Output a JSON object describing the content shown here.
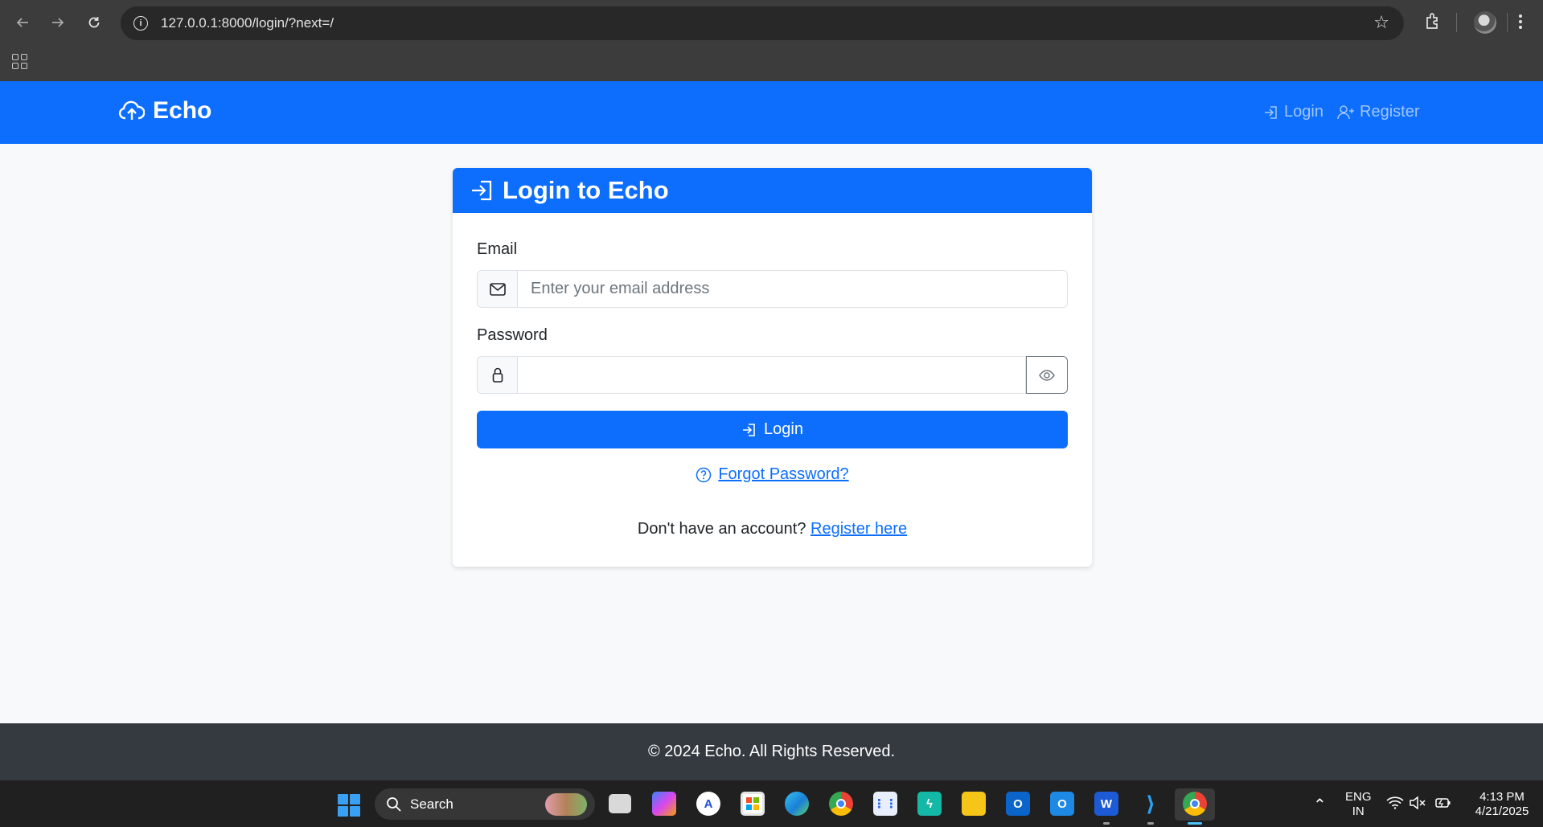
{
  "browser": {
    "url": "127.0.0.1:8000/login/?next=/"
  },
  "navbar": {
    "brand": "Echo",
    "login_label": "Login",
    "register_label": "Register"
  },
  "card": {
    "title": "Login to Echo",
    "email_label": "Email",
    "email_placeholder": "Enter your email address",
    "email_value": "",
    "password_label": "Password",
    "password_value": "",
    "login_button": "Login",
    "forgot_link": "Forgot Password?",
    "register_prompt": "Don't have an account?",
    "register_link": "Register here"
  },
  "footer": {
    "text": "© 2024 Echo. All Rights Reserved."
  },
  "taskbar": {
    "search_label": "Search",
    "apps": [
      "task-view",
      "copilot",
      "app-store",
      "microsoft-store",
      "edge",
      "chrome",
      "apps-grid",
      "power-automate",
      "file-explorer",
      "outlook-classic",
      "outlook-new",
      "word",
      "vscode",
      "chrome-active"
    ],
    "language_line1": "ENG",
    "language_line2": "IN",
    "time": "4:13 PM",
    "date": "4/21/2025"
  },
  "colors": {
    "primary": "#0d6efd",
    "footer_bg": "#343a40",
    "page_bg": "#f8f9fa"
  }
}
